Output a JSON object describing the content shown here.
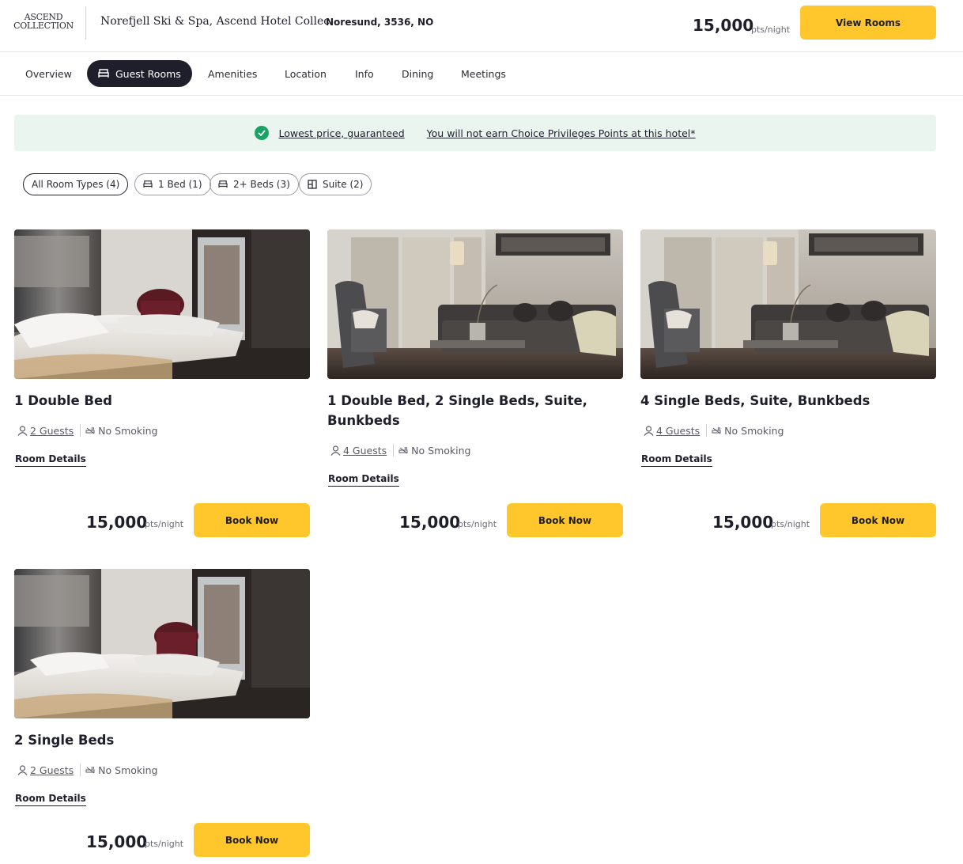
{
  "header": {
    "logo_line1": "ASCEND",
    "logo_line2": "COLLECTION",
    "hotel_name": "Norefjell Ski & Spa, Ascend Hotel Collec...",
    "location": "Noresund, 3536, NO",
    "price": "15,000",
    "price_unit": "pts/night",
    "cta": "View Rooms"
  },
  "tabs": [
    {
      "label": "Overview",
      "active": false
    },
    {
      "label": "Guest Rooms",
      "active": true
    },
    {
      "label": "Amenities",
      "active": false
    },
    {
      "label": "Location",
      "active": false
    },
    {
      "label": "Info",
      "active": false
    },
    {
      "label": "Dining",
      "active": false
    },
    {
      "label": "Meetings",
      "active": false
    }
  ],
  "banner": {
    "guarantee": "Lowest price, guaranteed",
    "points_notice": "You will not earn Choice Privileges Points at this hotel*"
  },
  "filters": [
    {
      "label": "All Room Types (4)",
      "icon": "none",
      "active": true
    },
    {
      "label": "1 Bed (1)",
      "icon": "bed-icon",
      "active": false
    },
    {
      "label": "2+ Beds (3)",
      "icon": "bed-icon",
      "active": false
    },
    {
      "label": "Suite (2)",
      "icon": "suite-icon",
      "active": false
    }
  ],
  "rooms": [
    {
      "title_line1": "1 Double Bed",
      "title_line2": "",
      "guests": "2 Guests",
      "smoking": "No Smoking",
      "details_label": "Room Details",
      "price": "15,000",
      "price_unit": "pts/night",
      "cta": "Book Now",
      "photo": "bedroom"
    },
    {
      "title_line1": "1 Double Bed, 2 Single Beds, Suite,",
      "title_line2": "Bunkbeds",
      "guests": "4 Guests",
      "smoking": "No Smoking",
      "details_label": "Room Details",
      "price": "15,000",
      "price_unit": "pts/night",
      "cta": "Book Now",
      "photo": "living-room"
    },
    {
      "title_line1": "4 Single Beds, Suite, Bunkbeds",
      "title_line2": "",
      "guests": "4 Guests",
      "smoking": "No Smoking",
      "details_label": "Room Details",
      "price": "15,000",
      "price_unit": "pts/night",
      "cta": "Book Now",
      "photo": "living-room"
    },
    {
      "title_line1": "2 Single Beds",
      "title_line2": "",
      "guests": "2 Guests",
      "smoking": "No Smoking",
      "details_label": "Room Details",
      "price": "15,000",
      "price_unit": "pts/night",
      "cta": "Book Now",
      "photo": "bedroom"
    }
  ],
  "colors": {
    "accent": "#ffc72c",
    "dark": "#1f1f2b",
    "banner_bg": "#e9f5ee",
    "success": "#19a463"
  }
}
